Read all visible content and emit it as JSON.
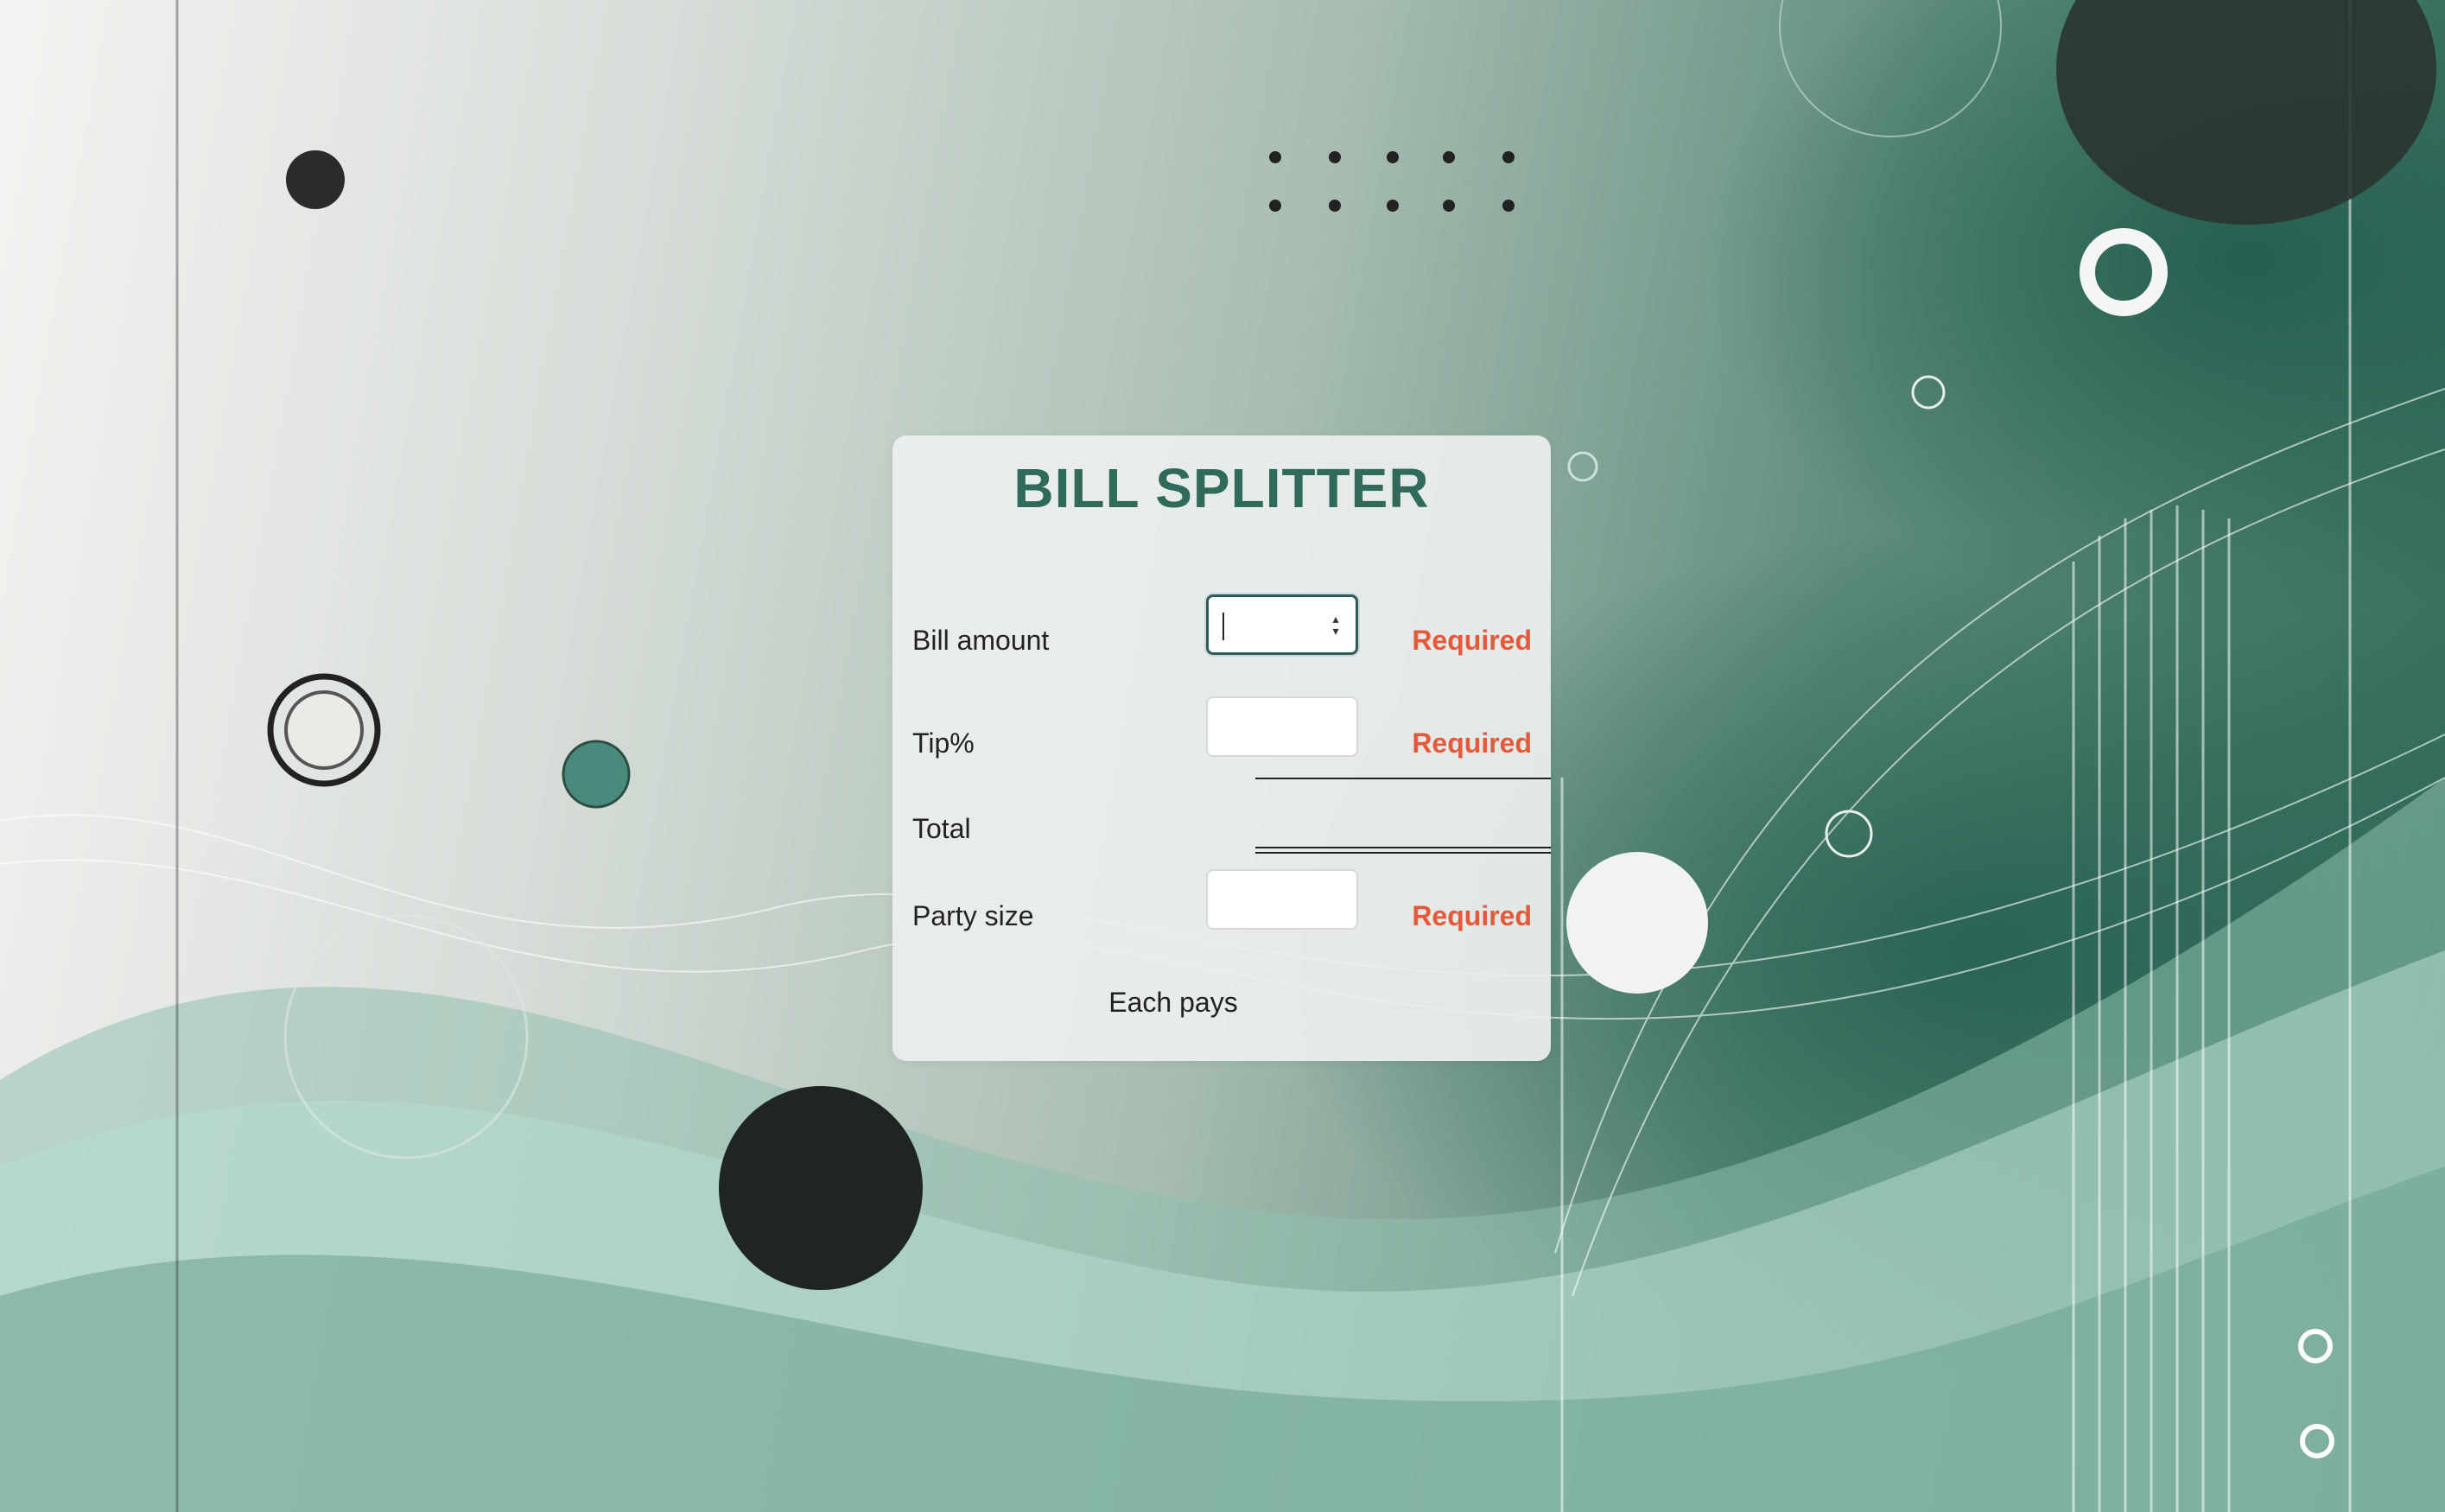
{
  "app": {
    "title": "BILL SPLITTER"
  },
  "form": {
    "bill_amount": {
      "label": "Bill amount",
      "value": "",
      "status": "Required"
    },
    "tip": {
      "label": "Tip%",
      "value": "",
      "status": "Required"
    },
    "total": {
      "label": "Total",
      "value": ""
    },
    "party_size": {
      "label": "Party size",
      "value": "",
      "status": "Required"
    },
    "each_pays": {
      "label": "Each pays",
      "value": ""
    }
  },
  "colors": {
    "title": "#2f6a5a",
    "required": "#e5593a",
    "focus_border": "#2d5e55"
  },
  "icons": {
    "spinner": "up-down-arrows"
  }
}
